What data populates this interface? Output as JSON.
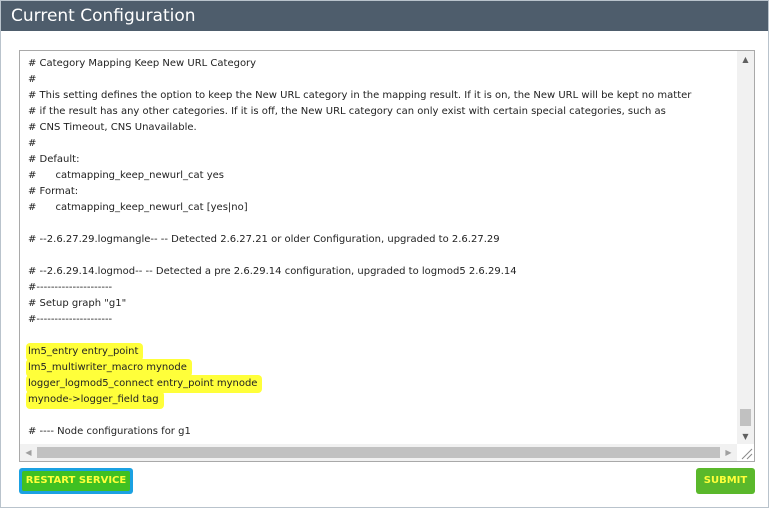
{
  "header": {
    "title": "Current Configuration"
  },
  "editor": {
    "lines": [
      "# Category Mapping Keep New URL Category",
      "#",
      "# This setting defines the option to keep the New URL category in the mapping result. If it is on, the New URL will be kept no matter",
      "# if the result has any other categories. If it is off, the New URL category can only exist with certain special categories, such as",
      "# CNS Timeout, CNS Unavailable.",
      "#",
      "# Default:",
      "#      catmapping_keep_newurl_cat yes",
      "# Format:",
      "#      catmapping_keep_newurl_cat [yes|no]",
      "",
      "# --2.6.27.29.logmangle-- -- Detected 2.6.27.21 or older Configuration, upgraded to 2.6.27.29",
      "",
      "# --2.6.29.14.logmod-- -- Detected a pre 2.6.29.14 configuration, upgraded to logmod5 2.6.29.14",
      "#---------------------",
      "# Setup graph \"g1\"",
      "#---------------------",
      "",
      "lm5_entry entry_point",
      "lm5_multiwriter_macro mynode",
      "logger_logmod5_connect entry_point mynode",
      "mynode->logger_field tag",
      "",
      "# ---- Node configurations for g1"
    ]
  },
  "buttons": {
    "restart": "RESTART SERVICE",
    "submit": "SUBMIT"
  },
  "icons": {
    "scroll_up": "▲",
    "scroll_down": "▼",
    "scroll_left": "◀",
    "scroll_right": "▶"
  }
}
